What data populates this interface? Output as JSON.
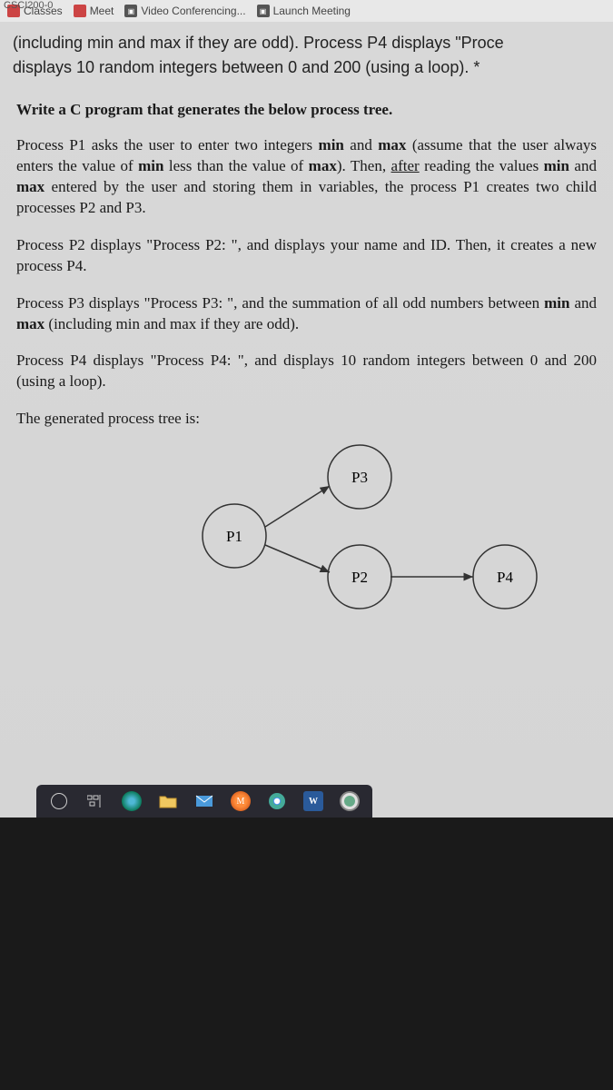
{
  "crop_id": "CSCI200-0",
  "tabs": {
    "classes": "Classes",
    "meet": "Meet",
    "video": "Video Conferencing...",
    "launch": "Launch Meeting"
  },
  "cut_top": "(including min and max if they are odd). Process P4 displays \"Proce",
  "cut_top2": "displays 10 random integers between 0 and 200 (using a loop). *",
  "intro": "Write a C program that generates the below process tree.",
  "p1_a": "Process P1 asks the user to enter two integers ",
  "p1_b": "min",
  "p1_c": " and ",
  "p1_d": "max",
  "p1_e": " (assume that the user always enters the value of ",
  "p1_f": "min",
  "p1_g": " less than the value of ",
  "p1_h": "max",
  "p1_i": "). Then, ",
  "p1_j": "after",
  "p1_k": " reading the values ",
  "p1_l": "min",
  "p1_m": " and ",
  "p1_n": "max",
  "p1_o": " entered by the user and storing them in variables, the process P1 creates two child processes P2 and P3.",
  "p2": "Process P2 displays \"Process P2: \", and displays your name and ID. Then, it creates a new process P4.",
  "p3_a": "Process P3 displays \"Process P3: \", and the summation of all odd numbers between ",
  "p3_b": "min",
  "p3_c": " and ",
  "p3_d": "max",
  "p3_e": " (including min and max if they are odd).",
  "p4": "Process P4 displays \"Process P4: \", and displays 10 random integers between 0 and 200 (using a loop).",
  "tree_caption": "The generated process tree is:",
  "nodes": {
    "p1": "P1",
    "p2": "P2",
    "p3": "P3",
    "p4": "P4"
  },
  "taskbar": {
    "word": "W",
    "cortana": "M"
  }
}
